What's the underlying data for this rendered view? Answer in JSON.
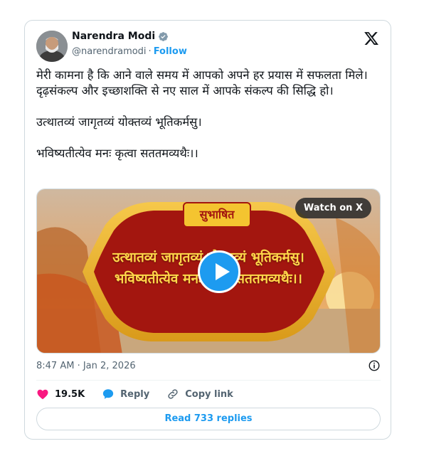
{
  "author": {
    "name": "Narendra Modi",
    "handle": "@narendramodi",
    "separator": "·",
    "follow_label": "Follow",
    "avatar_icon": "profile-photo",
    "verified_icon": "verified-badge-icon"
  },
  "tweet": {
    "text": "मेरी कामना है कि आने वाले समय में आपको अपने हर प्रयास में सफलता मिले। दृढ़संकल्प और इच्छाशक्ति से नए साल में आपके संकल्प की सिद्धि हो।\n\nउत्थातव्यं जागृतव्यं योक्तव्यं भूतिकर्मसु।\n\nभविष्यतीत्येव मनः कृत्वा सततमव्यथैः।।"
  },
  "media": {
    "badge": "सुभाषित",
    "line1": "उत्थातव्यं जागृतव्यं योक्तव्यं भूतिकर्मसु।",
    "line2": "भविष्यतीत्येव मनः कृत्वा सततमव्यथैः।।",
    "watch_label": "Watch on X"
  },
  "meta": {
    "timestamp": "8:47 AM · Jan 2, 2026"
  },
  "actions": {
    "likes": "19.5K",
    "reply_label": "Reply",
    "copy_link_label": "Copy link"
  },
  "footer": {
    "read_replies_label": "Read 733 replies"
  },
  "colors": {
    "accent": "#1d9bf0",
    "like": "#f91880",
    "text": "#0f1419",
    "muted": "#536471",
    "border": "#cfd9de"
  }
}
